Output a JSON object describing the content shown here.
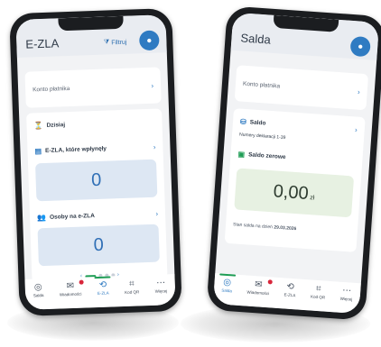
{
  "left_phone": {
    "header": {
      "title": "E-ZLA",
      "filter_label": "Filtruj",
      "filter_icon": "filter-icon",
      "avatar_icon": "profile-icon"
    },
    "account": {
      "label": "Konto płatnika",
      "chevron": "›"
    },
    "section_today": {
      "label": "Dzisiaj",
      "icon": "hourglass-icon"
    },
    "expired": {
      "label": "E-ZLA, które wpłynęły",
      "icon": "document-icon",
      "chevron": "›",
      "value": "0"
    },
    "persons": {
      "label": "Osoby na e-ZLA",
      "icon": "people-icon",
      "chevron": "›",
      "value": "0"
    },
    "pager": {
      "prev": "‹",
      "next": "›",
      "pages": 4,
      "active_index": 0
    },
    "nav": [
      {
        "label": "Salda",
        "icon": "balance-icon",
        "active": false,
        "badge": false
      },
      {
        "label": "Wiadomości",
        "icon": "mail-icon",
        "active": false,
        "badge": true
      },
      {
        "label": "E-ZLA",
        "icon": "ezla-icon",
        "active": true,
        "badge": false
      },
      {
        "label": "Kod QR",
        "icon": "qr-icon",
        "active": false,
        "badge": false
      },
      {
        "label": "Więcej",
        "icon": "more-icon",
        "active": false,
        "badge": false
      }
    ]
  },
  "right_phone": {
    "header": {
      "title": "Salda",
      "avatar_icon": "profile-icon"
    },
    "account": {
      "label": "Konto płatnika",
      "chevron": "›"
    },
    "saldo": {
      "label": "Saldo",
      "icon": "coins-icon",
      "chevron": "›",
      "declaration": "Numery deklaracji 1-39"
    },
    "saldo_zerowe": {
      "label": "Saldo zerowe",
      "icon": "wallet-icon",
      "value": "0,00",
      "unit": "zł"
    },
    "stan": {
      "prefix": "Stan salda na dzień",
      "date": "29.03.2026"
    },
    "nav": [
      {
        "label": "Salda",
        "icon": "balance-icon",
        "active": true,
        "badge": false
      },
      {
        "label": "Wiadomości",
        "icon": "mail-icon",
        "active": false,
        "badge": true
      },
      {
        "label": "E-ZLA",
        "icon": "ezla-icon",
        "active": false,
        "badge": false
      },
      {
        "label": "Kod QR",
        "icon": "qr-icon",
        "active": false,
        "badge": false
      },
      {
        "label": "Więcej",
        "icon": "more-icon",
        "active": false,
        "badge": false
      }
    ]
  }
}
